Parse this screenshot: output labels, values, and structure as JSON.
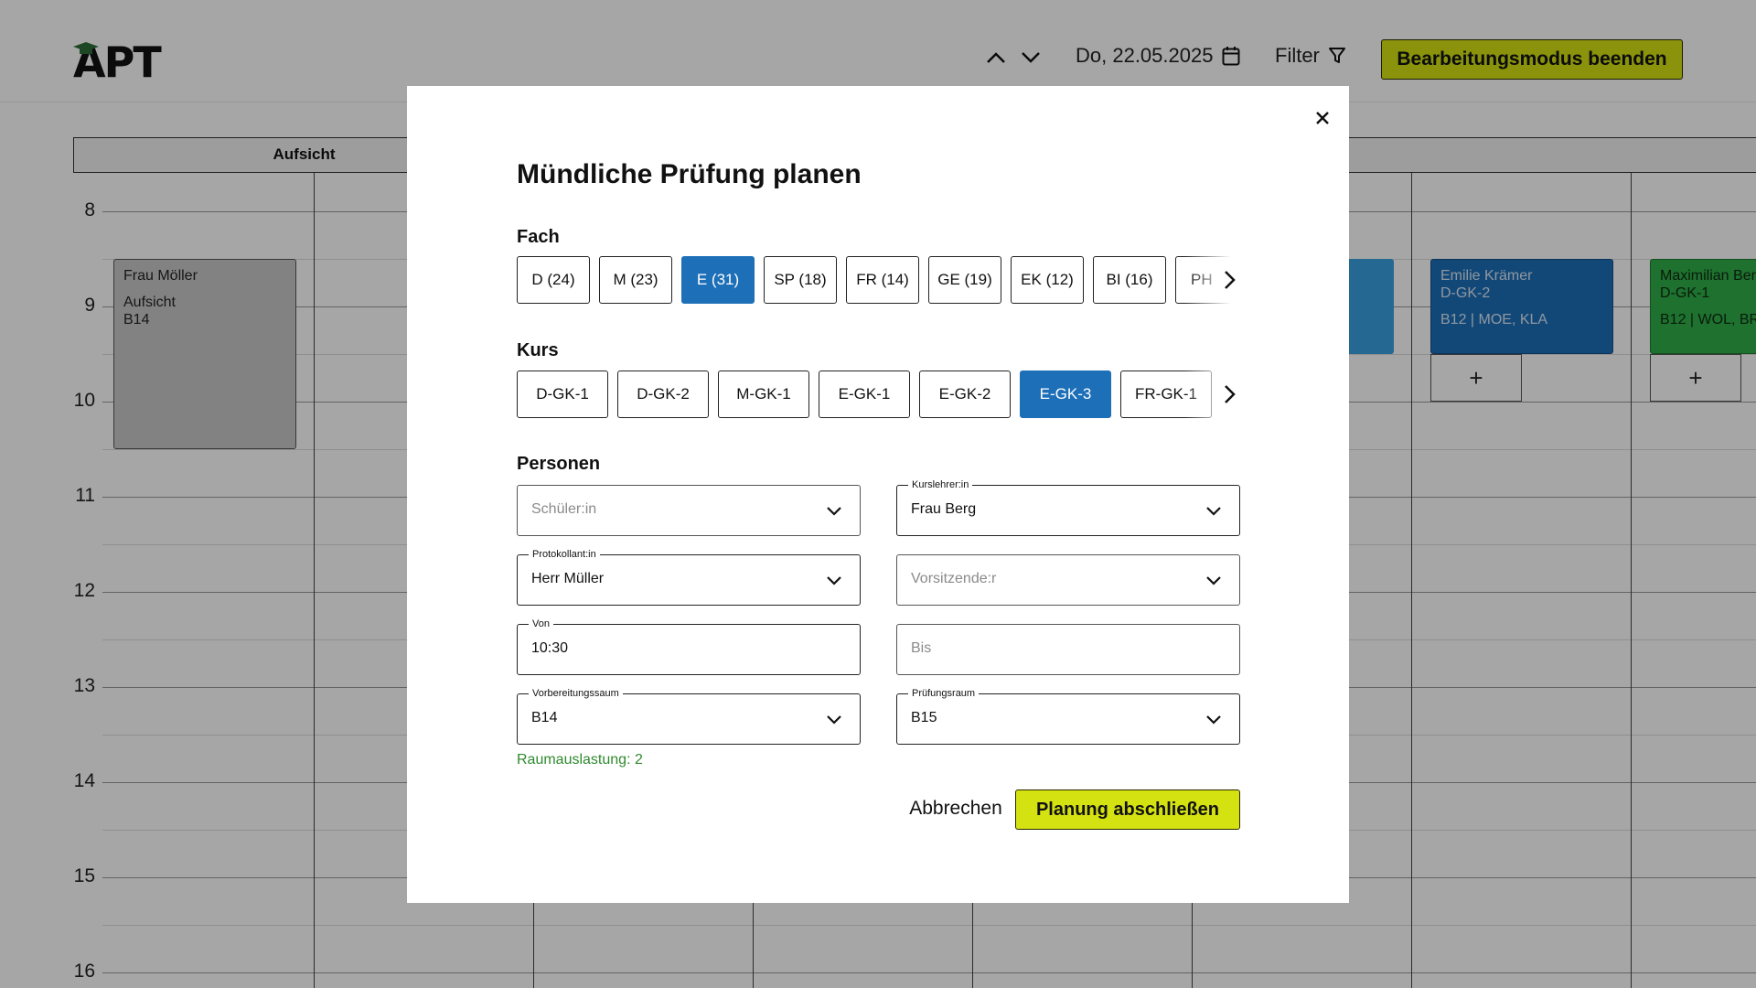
{
  "app": {
    "logo_text": "APT",
    "date": "Do, 22.05.2025",
    "filter_label": "Filter",
    "edit_mode_button": "Bearbeitungsmodus beenden"
  },
  "calendar": {
    "column_header": "Aufsicht",
    "hours": [
      "8",
      "9",
      "10",
      "11",
      "12",
      "13",
      "14",
      "15",
      "16"
    ],
    "events": {
      "gray": {
        "name": "Frau Möller",
        "type": "Aufsicht",
        "room": "B14"
      },
      "blue": {
        "name": "Emilie Krämer",
        "course": "D-GK-2",
        "details": "B12 | MOE, KLA"
      },
      "green": {
        "name": "Maximilian Ber",
        "course": "D-GK-1",
        "details": "B12 | WOL, BR"
      }
    },
    "plus_label": "+"
  },
  "modal": {
    "title": "Mündliche Prüfung planen",
    "subject_label": "Fach",
    "subjects": [
      {
        "label": "D (24)",
        "active": false
      },
      {
        "label": "M (23)",
        "active": false
      },
      {
        "label": "E (31)",
        "active": true
      },
      {
        "label": "SP (18)",
        "active": false
      },
      {
        "label": "FR (14)",
        "active": false
      },
      {
        "label": "GE (19)",
        "active": false
      },
      {
        "label": "EK (12)",
        "active": false
      },
      {
        "label": "BI (16)",
        "active": false
      },
      {
        "label": "PH",
        "active": false
      }
    ],
    "course_label": "Kurs",
    "courses": [
      {
        "label": "D-GK-1",
        "active": false
      },
      {
        "label": "D-GK-2",
        "active": false
      },
      {
        "label": "M-GK-1",
        "active": false
      },
      {
        "label": "E-GK-1",
        "active": false
      },
      {
        "label": "E-GK-2",
        "active": false
      },
      {
        "label": "E-GK-3",
        "active": true
      },
      {
        "label": "FR-GK-1",
        "active": false
      }
    ],
    "persons_label": "Personen",
    "fields": {
      "student": {
        "placeholder": "Schüler:in"
      },
      "teacher": {
        "label": "Kurslehrer:in",
        "value": "Frau Berg"
      },
      "recorder": {
        "label": "Protokollant:in",
        "value": "Herr Müller"
      },
      "chair": {
        "placeholder": "Vorsitzende:r"
      },
      "from": {
        "label": "Von",
        "value": "10:30"
      },
      "to": {
        "placeholder": "Bis"
      },
      "prep_room": {
        "label": "Vorbereitungssaum",
        "value": "B14"
      },
      "exam_room": {
        "label": "Prüfungsraum",
        "value": "B15"
      }
    },
    "room_load": "Raumauslastung: 2",
    "cancel_button": "Abbrechen",
    "finish_button": "Planung abschließen"
  },
  "colors": {
    "accent_yellow": "#d4e212",
    "active_blue": "#1d6fb8",
    "success_green": "#2f8a2f"
  }
}
